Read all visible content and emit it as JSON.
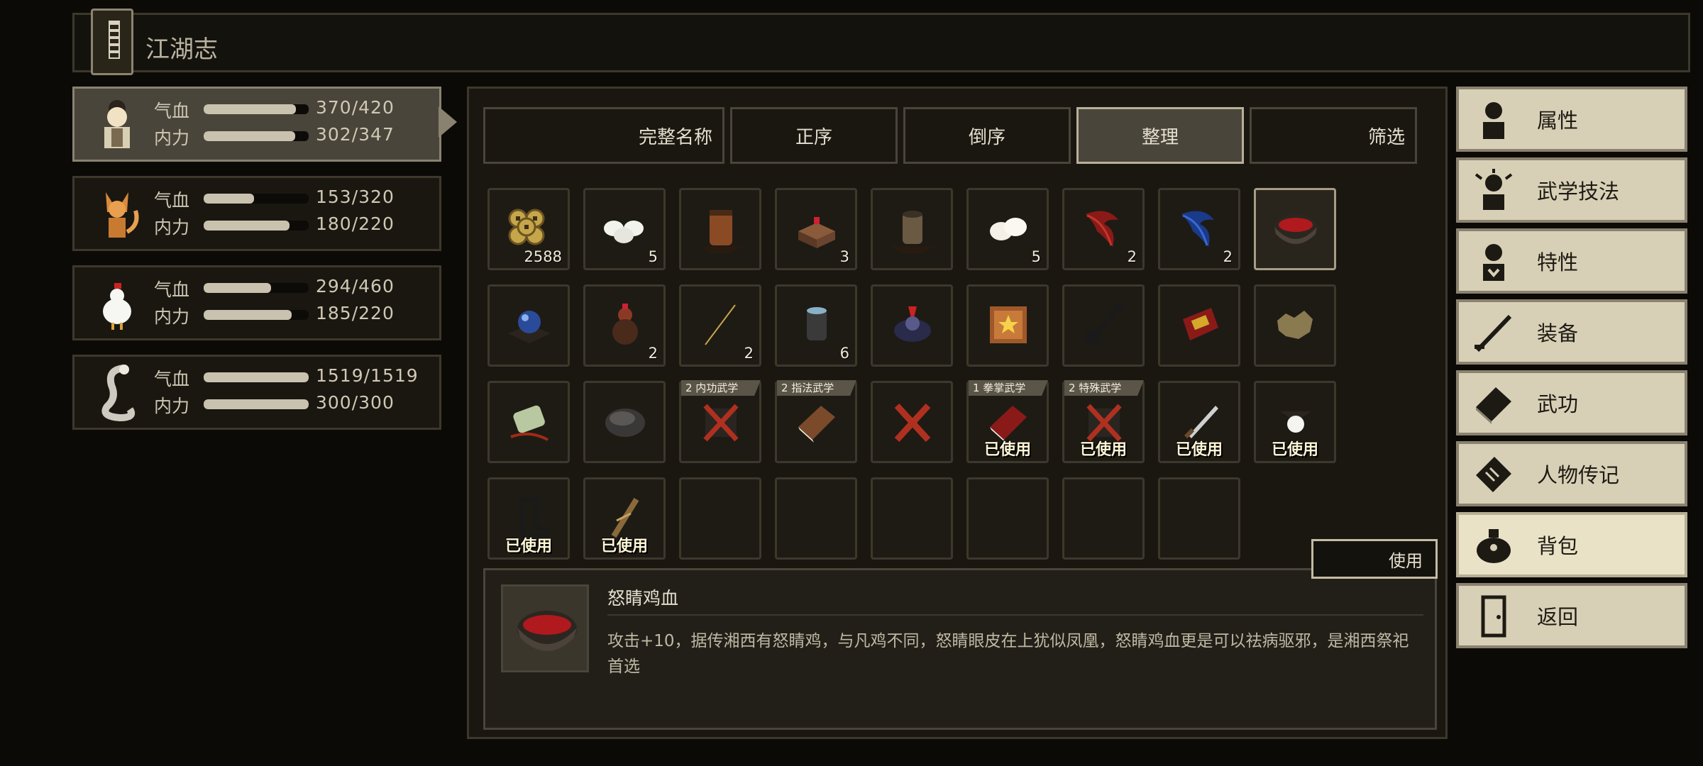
{
  "header": {
    "title": "江湖志"
  },
  "party": [
    {
      "hp_label": "气血",
      "mp_label": "内力",
      "hp": "370/420",
      "mp": "302/347",
      "hp_ratio": 0.88,
      "mp_ratio": 0.87,
      "portrait": "hero-portrait",
      "active": true
    },
    {
      "hp_label": "气血",
      "mp_label": "内力",
      "hp": "153/320",
      "mp": "180/220",
      "hp_ratio": 0.48,
      "mp_ratio": 0.82,
      "portrait": "fox-portrait"
    },
    {
      "hp_label": "气血",
      "mp_label": "内力",
      "hp": "294/460",
      "mp": "185/220",
      "hp_ratio": 0.64,
      "mp_ratio": 0.84,
      "portrait": "rooster-portrait"
    },
    {
      "hp_label": "气血",
      "mp_label": "内力",
      "hp": "1519/1519",
      "mp": "300/300",
      "hp_ratio": 1.0,
      "mp_ratio": 1.0,
      "portrait": "snake-portrait"
    }
  ],
  "filters": {
    "full_name": "完整名称",
    "ascending": "正序",
    "descending": "倒序",
    "organize": "整理",
    "filter": "筛选"
  },
  "inventory": [
    {
      "icon": "coins-icon",
      "count": "2588"
    },
    {
      "icon": "rice-balls-icon",
      "count": "5"
    },
    {
      "icon": "wine-jar-icon",
      "count": ""
    },
    {
      "icon": "box-icon",
      "count": "3"
    },
    {
      "icon": "pot-icon",
      "count": ""
    },
    {
      "icon": "buns-icon",
      "count": "5"
    },
    {
      "icon": "red-feather-icon",
      "count": "2"
    },
    {
      "icon": "blue-feather-icon",
      "count": "2"
    },
    {
      "icon": "blood-bowl-icon",
      "count": "",
      "selected": true
    },
    {
      "icon": "orb-icon",
      "count": ""
    },
    {
      "icon": "gourd-icon",
      "count": "2"
    },
    {
      "icon": "chopsticks-icon",
      "count": "2"
    },
    {
      "icon": "jar-icon",
      "count": "6"
    },
    {
      "icon": "rooster-item-icon",
      "count": ""
    },
    {
      "icon": "star-scroll-icon",
      "count": ""
    },
    {
      "icon": "shovel-icon",
      "count": ""
    },
    {
      "icon": "red-card-icon",
      "count": ""
    },
    {
      "icon": "pelt-icon",
      "count": ""
    },
    {
      "icon": "jade-pendant-icon",
      "count": ""
    },
    {
      "icon": "stone-icon",
      "count": ""
    },
    {
      "icon": "scroll-x-icon",
      "count": "",
      "tag": "2 内功武学"
    },
    {
      "icon": "manual-icon",
      "count": "",
      "tag": "2 指法武学"
    },
    {
      "icon": "red-cross-icon",
      "count": ""
    },
    {
      "icon": "red-book-icon",
      "count": "",
      "tag": "1 拳掌武学",
      "used": "已使用"
    },
    {
      "icon": "scroll-x-icon",
      "count": "",
      "tag": "2 特殊武学",
      "used": "已使用"
    },
    {
      "icon": "dagger-icon",
      "count": "",
      "used": "已使用"
    },
    {
      "icon": "pearl-icon",
      "count": "",
      "used": "已使用"
    },
    {
      "icon": "boot-icon",
      "count": "",
      "used": "已使用"
    },
    {
      "icon": "sandal-icon",
      "count": "",
      "used": "已使用"
    },
    {
      "icon": "",
      "count": ""
    },
    {
      "icon": "",
      "count": ""
    },
    {
      "icon": "",
      "count": ""
    },
    {
      "icon": "",
      "count": ""
    },
    {
      "icon": "",
      "count": ""
    },
    {
      "icon": "",
      "count": ""
    }
  ],
  "use_button": "使用",
  "detail": {
    "icon": "blood-bowl-icon",
    "name": "怒睛鸡血",
    "description": "攻击+10，据传湘西有怒睛鸡，与凡鸡不同，怒睛眼皮在上犹似凤凰，怒睛鸡血更是可以祛病驱邪，是湘西祭祀首选"
  },
  "menu": [
    {
      "label": "属性",
      "icon": "attributes-icon"
    },
    {
      "label": "武学技法",
      "icon": "martial-skills-icon"
    },
    {
      "label": "特性",
      "icon": "traits-icon"
    },
    {
      "label": "装备",
      "icon": "equipment-icon"
    },
    {
      "label": "武功",
      "icon": "kungfu-book-icon"
    },
    {
      "label": "人物传记",
      "icon": "biography-icon"
    },
    {
      "label": "背包",
      "icon": "bag-icon",
      "active": true
    },
    {
      "label": "返回",
      "icon": "return-door-icon"
    }
  ]
}
